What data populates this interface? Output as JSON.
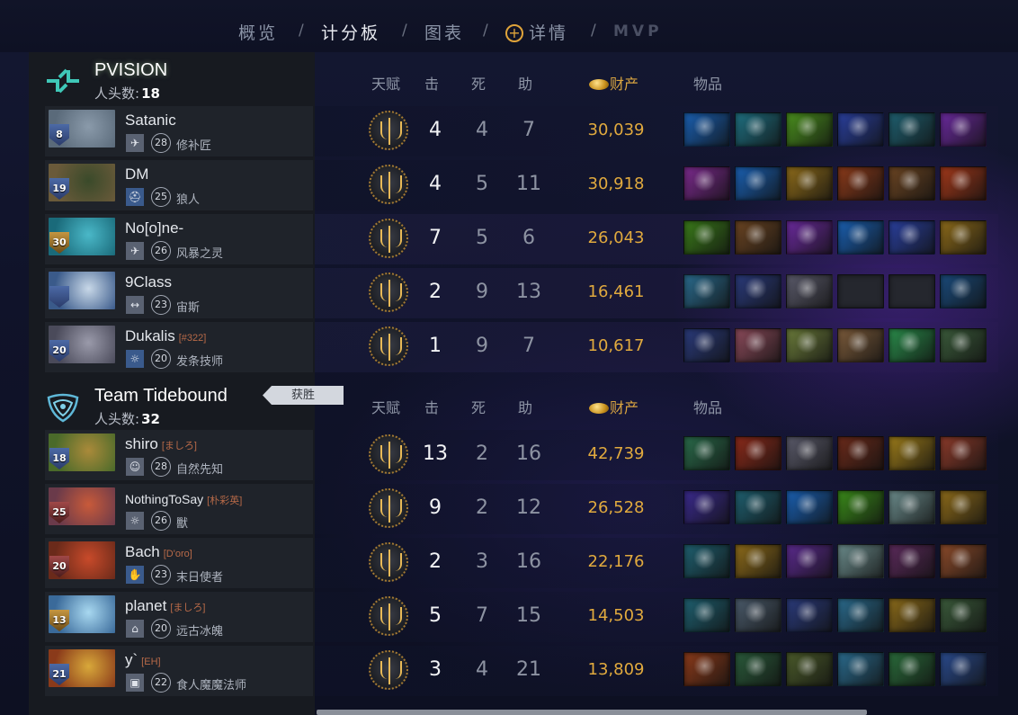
{
  "nav": {
    "items": [
      "概览",
      "计分板",
      "图表",
      "详情",
      "MVP"
    ],
    "separator": "/"
  },
  "columns": {
    "talent": "天赋",
    "kills": "击",
    "deaths": "死",
    "assists": "助",
    "networth": "财产",
    "items": "物品"
  },
  "teams": [
    {
      "name": "PVISION",
      "kills_label": "人头数:",
      "kills": "18",
      "players": [
        {
          "name": "Satanic",
          "tag": "",
          "level": "8",
          "role_icon": "runner-icon",
          "hero_level": "28",
          "hero": "修补匠",
          "kills": "4",
          "deaths": "4",
          "assists": "7",
          "networth": "30,039",
          "items": [
            "#1a5fb0",
            "#1f6f80",
            "#4a8f1e",
            "#2a3f9c",
            "#1f5f6f",
            "#6a2a9c"
          ]
        },
        {
          "name": "DM",
          "tag": "",
          "level": "19",
          "role_icon": "helmet-icon",
          "hero_level": "25",
          "hero": "狼人",
          "kills": "4",
          "deaths": "5",
          "assists": "11",
          "networth": "30,918",
          "items": [
            "#7a2a8c",
            "#1a5fb0",
            "#8c6a1a",
            "#8a3a1a",
            "#6a4422",
            "#a0381a"
          ]
        },
        {
          "name": "No[o]ne-",
          "tag": "",
          "level": "30",
          "role_icon": "runner-icon",
          "hero_level": "26",
          "hero": "风暴之灵",
          "kills": "7",
          "deaths": "5",
          "assists": "6",
          "networth": "26,043",
          "items": [
            "#3a7a1a",
            "#6a4422",
            "#6a2a9c",
            "#1a5fb0",
            "#2a3f9c",
            "#8c6a1a"
          ]
        },
        {
          "name": "9Class",
          "tag": "",
          "level": "",
          "role_icon": "ruler-icon",
          "hero_level": "23",
          "hero": "宙斯",
          "kills": "2",
          "deaths": "9",
          "assists": "13",
          "networth": "16,461",
          "items": [
            "#2a6a8c",
            "#2a3a7a",
            "#5a5a6a",
            "empty",
            "empty",
            "#1a4a7a"
          ]
        },
        {
          "name": "Dukalis",
          "tag": "[#322]",
          "level": "20",
          "role_icon": "gear-icon",
          "hero_level": "20",
          "hero": "发条技师",
          "kills": "1",
          "deaths": "9",
          "assists": "7",
          "networth": "10,617",
          "items": [
            "#2a3a7a",
            "#8a4a5a",
            "#6a7a3a",
            "#7a5a3a",
            "#2a8a4a",
            "#3a5a3a"
          ]
        }
      ]
    },
    {
      "name": "Team Tidebound",
      "kills_label": "人头数:",
      "kills": "32",
      "badge": "获胜",
      "players": [
        {
          "name": "shiro",
          "tag": "[ましろ]",
          "level": "18",
          "role_icon": "face-icon",
          "hero_level": "28",
          "hero": "自然先知",
          "kills": "13",
          "deaths": "2",
          "assists": "16",
          "networth": "42,739",
          "items": [
            "#2a6a4a",
            "#8a2a1a",
            "#5a5a6a",
            "#6a2a1a",
            "#9a7a1a",
            "#8a3a2a"
          ]
        },
        {
          "name": "NothingToSay",
          "tag": "[朴彩英]",
          "level": "25",
          "role_icon": "gear-icon",
          "hero_level": "26",
          "hero": "獸",
          "kills": "9",
          "deaths": "2",
          "assists": "12",
          "networth": "26,528",
          "items": [
            "#3a2a8c",
            "#1f5f6f",
            "#1a5fb0",
            "#3a8a1a",
            "#6a8a8a",
            "#8c6a1a"
          ]
        },
        {
          "name": "Bach",
          "tag": "[D'oro]",
          "level": "20",
          "role_icon": "hand-icon",
          "hero_level": "23",
          "hero": "末日使者",
          "kills": "2",
          "deaths": "3",
          "assists": "16",
          "networth": "22,176",
          "items": [
            "#1f5f6f",
            "#8c6a1a",
            "#5a2a8c",
            "#6a8a8a",
            "#5a2a5a",
            "#8a4a2a"
          ]
        },
        {
          "name": "planet",
          "tag": "[ましろ]",
          "level": "13",
          "role_icon": "boot-icon",
          "hero_level": "20",
          "hero": "远古冰魄",
          "kills": "5",
          "deaths": "7",
          "assists": "15",
          "networth": "14,503",
          "items": [
            "#1f5f6f",
            "#4a5a6a",
            "#2a3a7a",
            "#2a6a8c",
            "#8a6a1a",
            "#3a5a3a"
          ]
        },
        {
          "name": "y`",
          "tag": "[EH]",
          "level": "21",
          "role_icon": "mask-icon",
          "hero_level": "22",
          "hero": "食人魔魔法师",
          "kills": "3",
          "deaths": "4",
          "assists": "21",
          "networth": "13,809",
          "items": [
            "#8a3a1a",
            "#2a5a3a",
            "#4a5a2a",
            "#2a6a8c",
            "#2a6a3a",
            "#2a4a8c"
          ]
        }
      ]
    }
  ]
}
